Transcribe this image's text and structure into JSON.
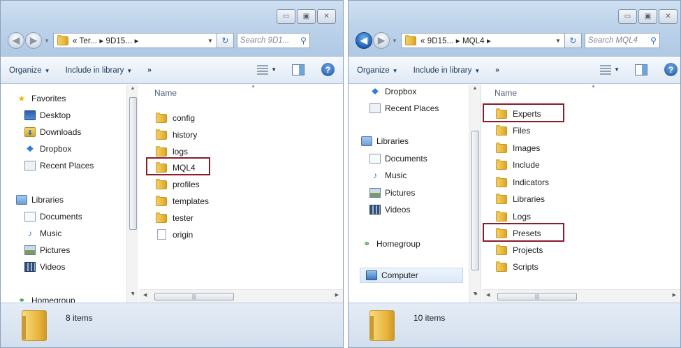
{
  "left_window": {
    "address": "« Ter... ▸ 9D15... ▸",
    "search_placeholder": "Search 9D1...",
    "toolbar": {
      "organize": "Organize",
      "include_in_library": "Include in library",
      "more": "»"
    },
    "column_header": "Name",
    "nav": {
      "favorites": "Favorites",
      "desktop": "Desktop",
      "downloads": "Downloads",
      "dropbox": "Dropbox",
      "recent_places": "Recent Places",
      "libraries": "Libraries",
      "documents": "Documents",
      "music": "Music",
      "pictures": "Pictures",
      "videos": "Videos",
      "homegroup": "Homegroup"
    },
    "files": [
      "config",
      "history",
      "logs",
      "MQL4",
      "profiles",
      "templates",
      "tester",
      "origin"
    ],
    "highlighted": "MQL4",
    "status": "8 items"
  },
  "right_window": {
    "address": "« 9D15... ▸ MQL4 ▸",
    "search_placeholder": "Search MQL4",
    "toolbar": {
      "organize": "Organize",
      "include_in_library": "Include in library",
      "more": "»"
    },
    "column_header": "Name",
    "nav": {
      "dropbox": "Dropbox",
      "recent_places": "Recent Places",
      "libraries": "Libraries",
      "documents": "Documents",
      "music": "Music",
      "pictures": "Pictures",
      "videos": "Videos",
      "homegroup": "Homegroup",
      "computer": "Computer"
    },
    "files": [
      "Experts",
      "Files",
      "Images",
      "Include",
      "Indicators",
      "Libraries",
      "Logs",
      "Presets",
      "Projects",
      "Scripts"
    ],
    "highlighted": [
      "Experts",
      "Presets"
    ],
    "status": "10 items"
  },
  "colors": {
    "highlight_border": "#8b1c2b",
    "title_bar": "#bcd3ea",
    "toolbar_text": "#1e395b"
  }
}
